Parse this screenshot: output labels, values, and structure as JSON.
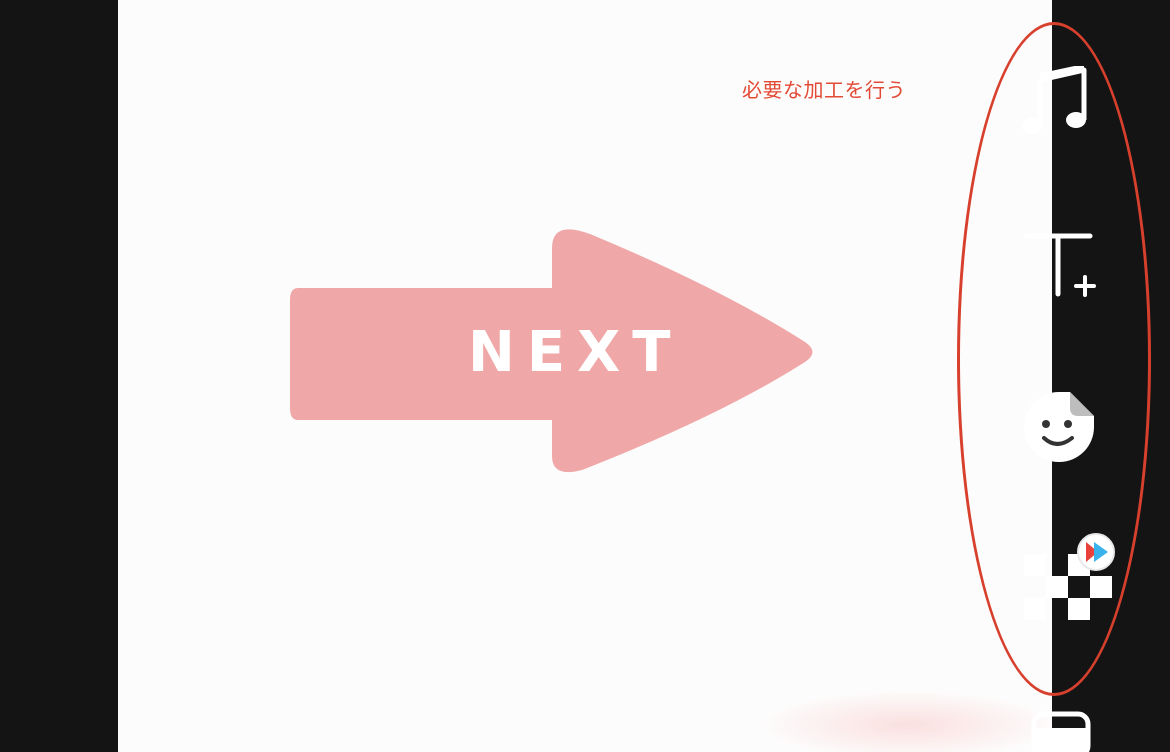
{
  "annotation": {
    "text": "必要な加工を行う",
    "color": "#e24a35"
  },
  "canvas": {
    "graphic": {
      "label": "NEXT",
      "arrow_color": "#f0a7a7",
      "text_color": "#ffffff"
    }
  },
  "toolbar": {
    "highlight_color": "#d8402e",
    "tools": [
      {
        "icon": "music-note-icon"
      },
      {
        "icon": "add-text-icon"
      },
      {
        "icon": "sticker-icon"
      },
      {
        "icon": "effects-icon"
      },
      {
        "icon": "template-icon"
      }
    ]
  }
}
